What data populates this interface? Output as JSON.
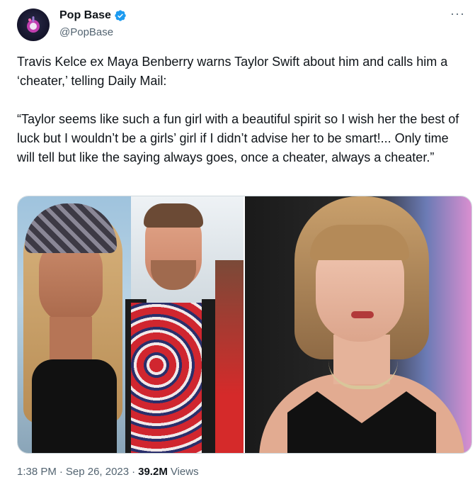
{
  "author": {
    "display_name": "Pop Base",
    "handle": "@PopBase",
    "verified": true,
    "avatar_icon": "pop-base-logo-icon"
  },
  "more_label": "···",
  "tweet": {
    "text": "Travis Kelce ex Maya Benberry warns Taylor Swift about him and calls him a ‘cheater,’ telling Daily Mail:\n\n“Taylor seems like such a fun girl with a beautiful spirit so I wish her the best of luck but I wouldn’t be a girls’ girl if I didn’t advise her to be smart!... Only time will tell but like the saying always goes, once a cheater, always a cheater.”"
  },
  "footer": {
    "time": "1:38 PM",
    "date": "Sep 26, 2023",
    "separator": "·",
    "views_count": "39.2M",
    "views_label": "Views"
  },
  "colors": {
    "verified_blue": "#1d9bf0",
    "secondary_text": "#536471",
    "primary_text": "#0f1419",
    "border": "#cfd9de"
  }
}
